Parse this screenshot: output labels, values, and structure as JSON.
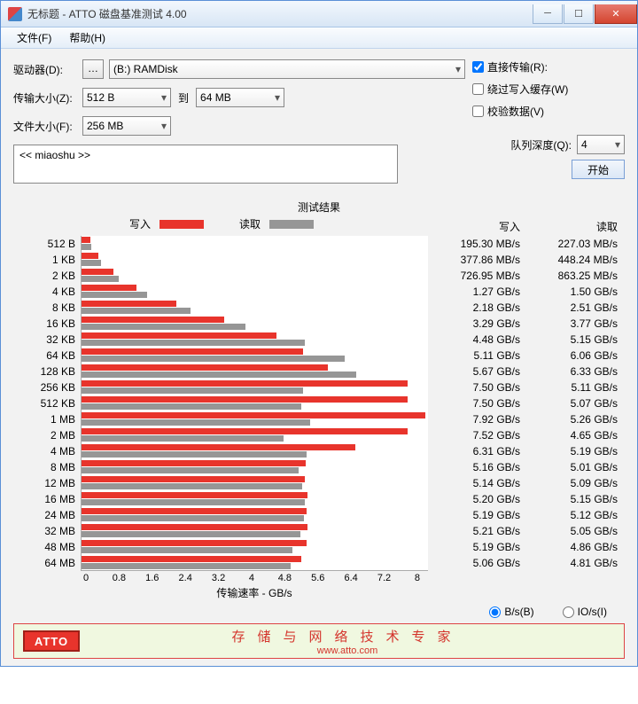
{
  "title": "无标题 - ATTO 磁盘基准测试 4.00",
  "menu": {
    "file": "文件(F)",
    "help": "帮助(H)"
  },
  "form": {
    "drive_lbl": "驱动器(D):",
    "drive_val": "(B:) RAMDisk",
    "xfer_lbl": "传输大小(Z):",
    "xfer_from": "512 B",
    "to": "到",
    "xfer_to": "64 MB",
    "filesize_lbl": "文件大小(F):",
    "filesize_val": "256 MB",
    "direct": "直接传输(R):",
    "bypass": "绕过写入缓存(W)",
    "verify": "校验数据(V)",
    "qd_lbl": "队列深度(Q):",
    "qd_val": "4",
    "textarea": "<< miaoshu >>",
    "start": "开始"
  },
  "results": {
    "title": "测试结果",
    "legend_write": "写入",
    "legend_read": "读取",
    "col_write": "写入",
    "col_read": "读取",
    "xlabel": "传输速率 - GB/s",
    "radio_bs": "B/s(B)",
    "radio_ios": "IO/s(I)"
  },
  "footer": {
    "logo": "ATTO",
    "line1": "存储与网络技术专家",
    "line2": "www.atto.com"
  },
  "chart_data": {
    "type": "bar",
    "xlabel": "传输速率 - GB/s",
    "xlim": [
      0,
      8
    ],
    "xticks": [
      0,
      0.8,
      1.6,
      2.4,
      3.2,
      4.0,
      4.8,
      5.6,
      6.4,
      7.2,
      8
    ],
    "categories": [
      "512 B",
      "1 KB",
      "2 KB",
      "4 KB",
      "8 KB",
      "16 KB",
      "32 KB",
      "64 KB",
      "128 KB",
      "256 KB",
      "512 KB",
      "1 MB",
      "2 MB",
      "4 MB",
      "8 MB",
      "12 MB",
      "16 MB",
      "24 MB",
      "32 MB",
      "48 MB",
      "64 MB"
    ],
    "series": [
      {
        "name": "写入",
        "values_gbs": [
          0.1953,
          0.37786,
          0.72695,
          1.27,
          2.18,
          3.29,
          4.48,
          5.11,
          5.67,
          7.5,
          7.5,
          7.92,
          7.52,
          6.31,
          5.16,
          5.14,
          5.2,
          5.19,
          5.21,
          5.19,
          5.06
        ],
        "display": [
          "195.30 MB/s",
          "377.86 MB/s",
          "726.95 MB/s",
          "1.27 GB/s",
          "2.18 GB/s",
          "3.29 GB/s",
          "4.48 GB/s",
          "5.11 GB/s",
          "5.67 GB/s",
          "7.50 GB/s",
          "7.50 GB/s",
          "7.92 GB/s",
          "7.52 GB/s",
          "6.31 GB/s",
          "5.16 GB/s",
          "5.14 GB/s",
          "5.20 GB/s",
          "5.19 GB/s",
          "5.21 GB/s",
          "5.19 GB/s",
          "5.06 GB/s"
        ]
      },
      {
        "name": "读取",
        "values_gbs": [
          0.22703,
          0.44824,
          0.86325,
          1.5,
          2.51,
          3.77,
          5.15,
          6.06,
          6.33,
          5.11,
          5.07,
          5.26,
          4.65,
          5.19,
          5.01,
          5.09,
          5.15,
          5.12,
          5.05,
          4.86,
          4.81
        ],
        "display": [
          "227.03 MB/s",
          "448.24 MB/s",
          "863.25 MB/s",
          "1.50 GB/s",
          "2.51 GB/s",
          "3.77 GB/s",
          "5.15 GB/s",
          "6.06 GB/s",
          "6.33 GB/s",
          "5.11 GB/s",
          "5.07 GB/s",
          "5.26 GB/s",
          "4.65 GB/s",
          "5.19 GB/s",
          "5.01 GB/s",
          "5.09 GB/s",
          "5.15 GB/s",
          "5.12 GB/s",
          "5.05 GB/s",
          "4.86 GB/s",
          "4.81 GB/s"
        ]
      }
    ]
  }
}
